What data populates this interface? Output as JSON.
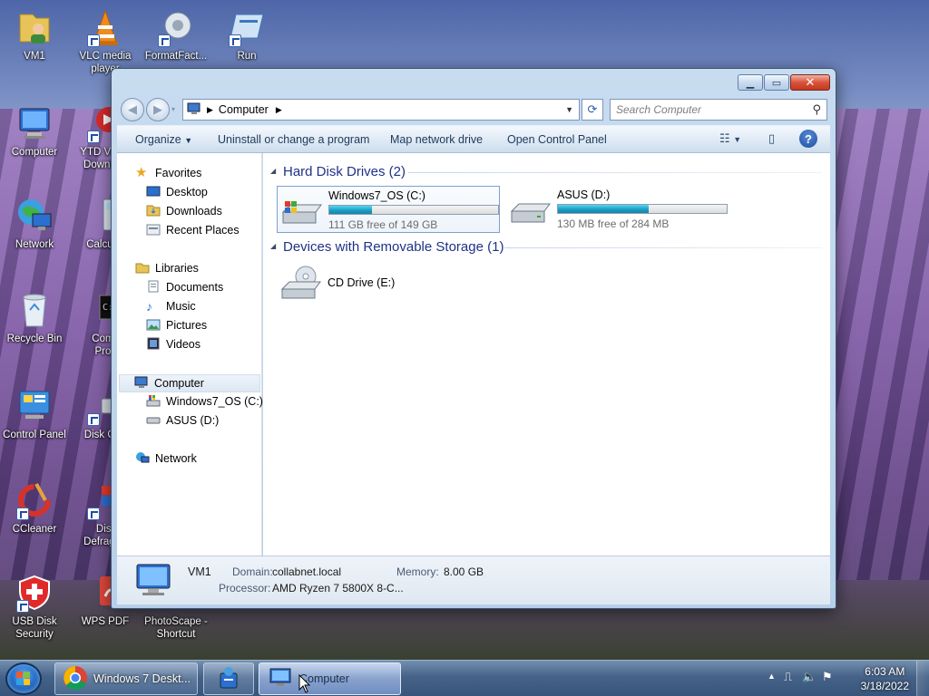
{
  "desktop": {
    "icons": [
      {
        "label": "VM1"
      },
      {
        "label": "VLC media player"
      },
      {
        "label": "FormatFact..."
      },
      {
        "label": "Run"
      },
      {
        "label": "Computer"
      },
      {
        "label": "YTD Video Downlo..."
      },
      {
        "label": "Network"
      },
      {
        "label": "Calcul..."
      },
      {
        "label": "Recycle Bin"
      },
      {
        "label": "Comm... Prom..."
      },
      {
        "label": "Control Panel"
      },
      {
        "label": "Disk Cle..."
      },
      {
        "label": "CCleaner"
      },
      {
        "label": "Dis... Defragm..."
      },
      {
        "label": "USB Disk Security"
      },
      {
        "label": "WPS PDF"
      },
      {
        "label": "PhotoScape - Shortcut"
      }
    ]
  },
  "window": {
    "address": {
      "segment": "Computer"
    },
    "search_placeholder": "Search Computer",
    "toolbar": {
      "organize": "Organize",
      "uninstall": "Uninstall or change a program",
      "map_drive": "Map network drive",
      "control_panel": "Open Control Panel",
      "help": "?"
    },
    "nav": {
      "favorites": "Favorites",
      "desktop": "Desktop",
      "downloads": "Downloads",
      "recent": "Recent Places",
      "libraries": "Libraries",
      "documents": "Documents",
      "music": "Music",
      "pictures": "Pictures",
      "videos": "Videos",
      "computer": "Computer",
      "drive_c": "Windows7_OS (C:)",
      "drive_d": "ASUS (D:)",
      "network": "Network"
    },
    "groups": {
      "hdd": "Hard Disk Drives (2)",
      "removable": "Devices with Removable Storage (1)"
    },
    "drives": [
      {
        "name": "Windows7_OS (C:)",
        "free": "111 GB free of 149 GB",
        "used_fraction": 0.255
      },
      {
        "name": "ASUS (D:)",
        "free": "130 MB free of 284 MB",
        "used_fraction": 0.54
      }
    ],
    "cd_drive": "CD Drive (E:)",
    "details": {
      "name": "VM1",
      "domain_label": "Domain:",
      "domain_value": "collabnet.local",
      "memory_label": "Memory:",
      "memory_value": "8.00 GB",
      "processor_label": "Processor:",
      "processor_value": "AMD Ryzen 7 5800X 8-C..."
    }
  },
  "taskbar": {
    "chrome": "Windows 7 Deskt...",
    "computer": "Computer",
    "time": "6:03 AM",
    "date": "3/18/2022"
  },
  "colors": {
    "accent": "#1e3287",
    "bar_fill": "#1b9fc5"
  }
}
